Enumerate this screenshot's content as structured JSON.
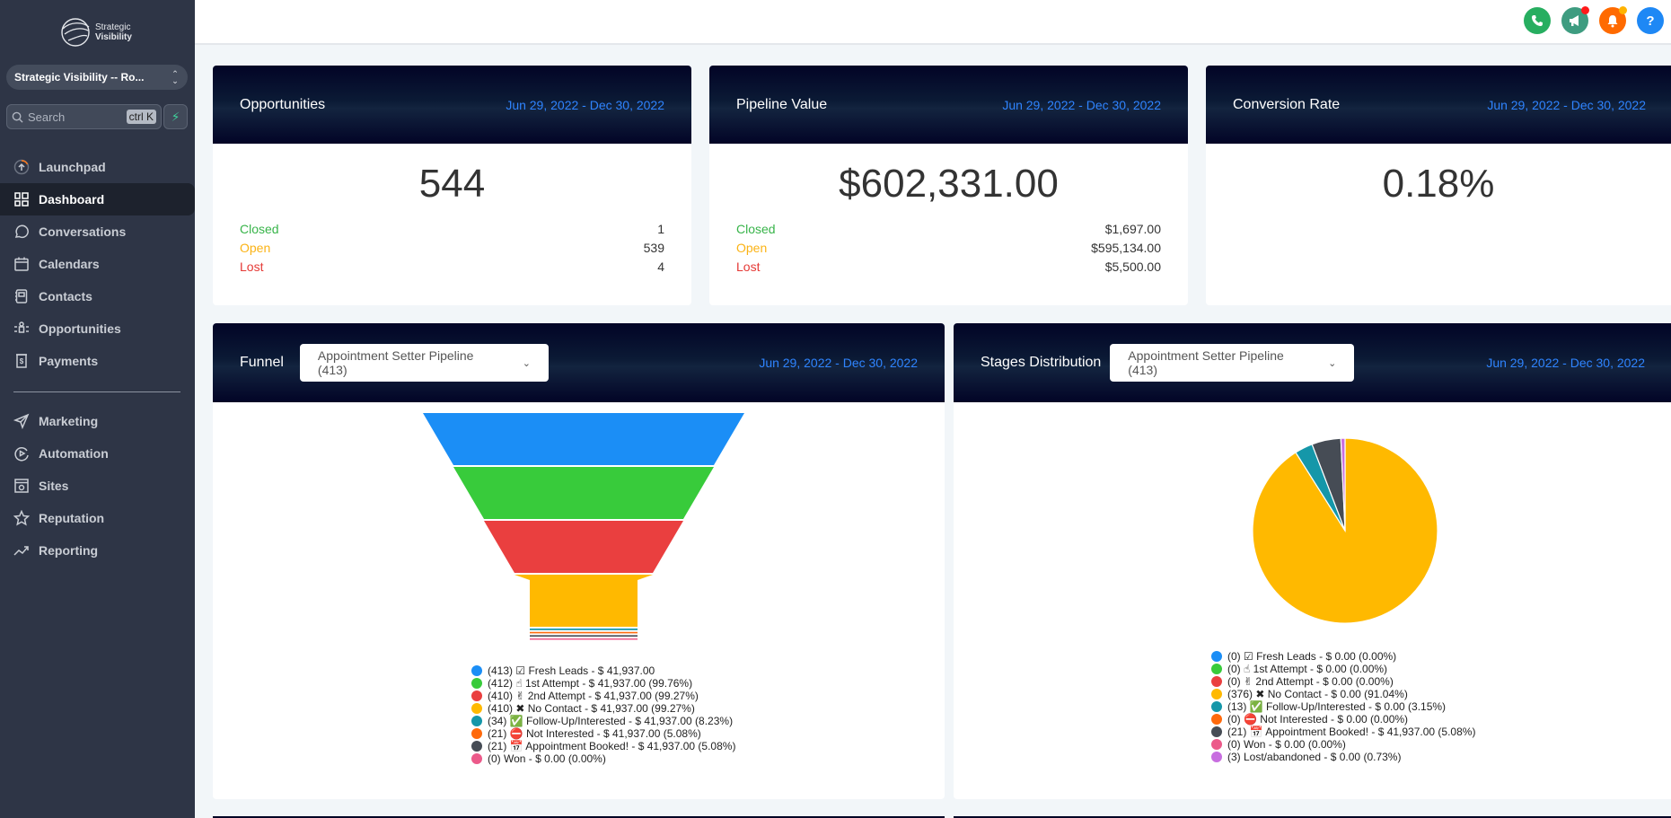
{
  "brand": {
    "line1": "Strategic",
    "line2": "Visibility"
  },
  "account": {
    "name": "Strategic Visibility -- Ro..."
  },
  "search": {
    "placeholder": "Search",
    "shortcut": "ctrl K"
  },
  "sidebar": {
    "items": [
      {
        "label": "Launchpad",
        "icon": "launchpad-icon",
        "active": false
      },
      {
        "label": "Dashboard",
        "icon": "dashboard-icon",
        "active": true
      },
      {
        "label": "Conversations",
        "icon": "chat-bubble-icon",
        "active": false
      },
      {
        "label": "Calendars",
        "icon": "calendar-icon",
        "active": false
      },
      {
        "label": "Contacts",
        "icon": "contacts-book-icon",
        "active": false
      },
      {
        "label": "Opportunities",
        "icon": "opportunities-icon",
        "active": false
      },
      {
        "label": "Payments",
        "icon": "payments-icon",
        "active": false
      }
    ],
    "items2": [
      {
        "label": "Marketing",
        "icon": "send-icon"
      },
      {
        "label": "Automation",
        "icon": "automation-icon"
      },
      {
        "label": "Sites",
        "icon": "sites-icon"
      },
      {
        "label": "Reputation",
        "icon": "star-icon"
      },
      {
        "label": "Reporting",
        "icon": "trend-icon"
      }
    ]
  },
  "topbar": {
    "icons": [
      {
        "name": "phone-icon",
        "color": "#27ae60"
      },
      {
        "name": "megaphone-icon",
        "color": "#3e9c80",
        "badge": "#ff1a1a"
      },
      {
        "name": "bell-icon",
        "color": "#ff6a00",
        "badge": "#ffb300"
      },
      {
        "name": "help-icon",
        "color": "#1e88f5"
      }
    ]
  },
  "date_range": "Jun 29, 2022 - Dec 30, 2022",
  "cards": {
    "opportunities": {
      "title": "Opportunities",
      "value": "544",
      "closed_label": "Closed",
      "closed": "1",
      "open_label": "Open",
      "open": "539",
      "lost_label": "Lost",
      "lost": "4"
    },
    "pipeline": {
      "title": "Pipeline Value",
      "value": "$602,331.00",
      "closed_label": "Closed",
      "closed": "$1,697.00",
      "open_label": "Open",
      "open": "$595,134.00",
      "lost_label": "Lost",
      "lost": "$5,500.00"
    },
    "conversion": {
      "title": "Conversion Rate",
      "value": "0.18%"
    }
  },
  "funnel": {
    "title": "Funnel",
    "pipeline_select": "Appointment Setter Pipeline (413)"
  },
  "stages": {
    "title": "Stages Distribution",
    "pipeline_select": "Appointment Setter Pipeline (413)"
  },
  "chart_data": [
    {
      "type": "funnel",
      "title": "Funnel",
      "categories": [
        "Fresh Leads",
        "1st Attempt",
        "2nd Attempt",
        "No Contact",
        "Follow-Up/Interested",
        "Not Interested",
        "Appointment Booked!",
        "Won"
      ],
      "counts": [
        413,
        412,
        410,
        410,
        34,
        21,
        21,
        0
      ],
      "values": [
        "$ 41,937.00",
        "$ 41,937.00",
        "$ 41,937.00",
        "$ 41,937.00",
        "$ 41,937.00",
        "$ 41,937.00",
        "$ 41,937.00",
        "$ 0.00"
      ],
      "percents": [
        "",
        "99.76%",
        "99.27%",
        "99.27%",
        "8.23%",
        "5.08%",
        "5.08%",
        "0.00%"
      ],
      "emojis": [
        "☑",
        "☝",
        "✌",
        "✖",
        "✅",
        "⛔",
        "📅",
        ""
      ],
      "colors": [
        "#1b8ef6",
        "#38cb3b",
        "#ea3f3f",
        "#ffb900",
        "#1597a9",
        "#ff6a0c",
        "#464c55",
        "#ec5a8a"
      ],
      "legend": [
        "(413) ☑ Fresh Leads - $ 41,937.00",
        "(412) ☝ 1st Attempt - $ 41,937.00 (99.76%)",
        "(410) ✌ 2nd Attempt - $ 41,937.00 (99.27%)",
        "(410) ✖ No Contact - $ 41,937.00 (99.27%)",
        "(34) ✅ Follow-Up/Interested - $ 41,937.00 (8.23%)",
        "(21) ⛔ Not Interested - $ 41,937.00 (5.08%)",
        "(21) 📅 Appointment Booked! - $ 41,937.00 (5.08%)",
        "(0) Won - $ 0.00 (0.00%)"
      ]
    },
    {
      "type": "pie",
      "title": "Stages Distribution",
      "categories": [
        "Fresh Leads",
        "1st Attempt",
        "2nd Attempt",
        "No Contact",
        "Follow-Up/Interested",
        "Not Interested",
        "Appointment Booked!",
        "Won",
        "Lost/abandoned"
      ],
      "counts": [
        0,
        0,
        0,
        376,
        13,
        0,
        21,
        0,
        3
      ],
      "percents": [
        0.0,
        0.0,
        0.0,
        91.04,
        3.15,
        0.0,
        5.08,
        0.0,
        0.73
      ],
      "colors": [
        "#1b8ef6",
        "#38cb3b",
        "#ea3f3f",
        "#ffb900",
        "#1597a9",
        "#ff6a0c",
        "#464c55",
        "#ec5a8a",
        "#c86ee0"
      ],
      "legend": [
        "(0) ☑ Fresh Leads - $ 0.00 (0.00%)",
        "(0) ☝ 1st Attempt - $ 0.00 (0.00%)",
        "(0) ✌ 2nd Attempt - $ 0.00 (0.00%)",
        "(376) ✖ No Contact - $ 0.00 (91.04%)",
        "(13) ✅ Follow-Up/Interested - $ 0.00 (3.15%)",
        "(0) ⛔ Not Interested - $ 0.00 (0.00%)",
        "(21) 📅 Appointment Booked! - $ 41,937.00 (5.08%)",
        "(0) Won - $ 0.00 (0.00%)",
        "(3) Lost/abandoned - $ 0.00 (0.73%)"
      ]
    }
  ]
}
